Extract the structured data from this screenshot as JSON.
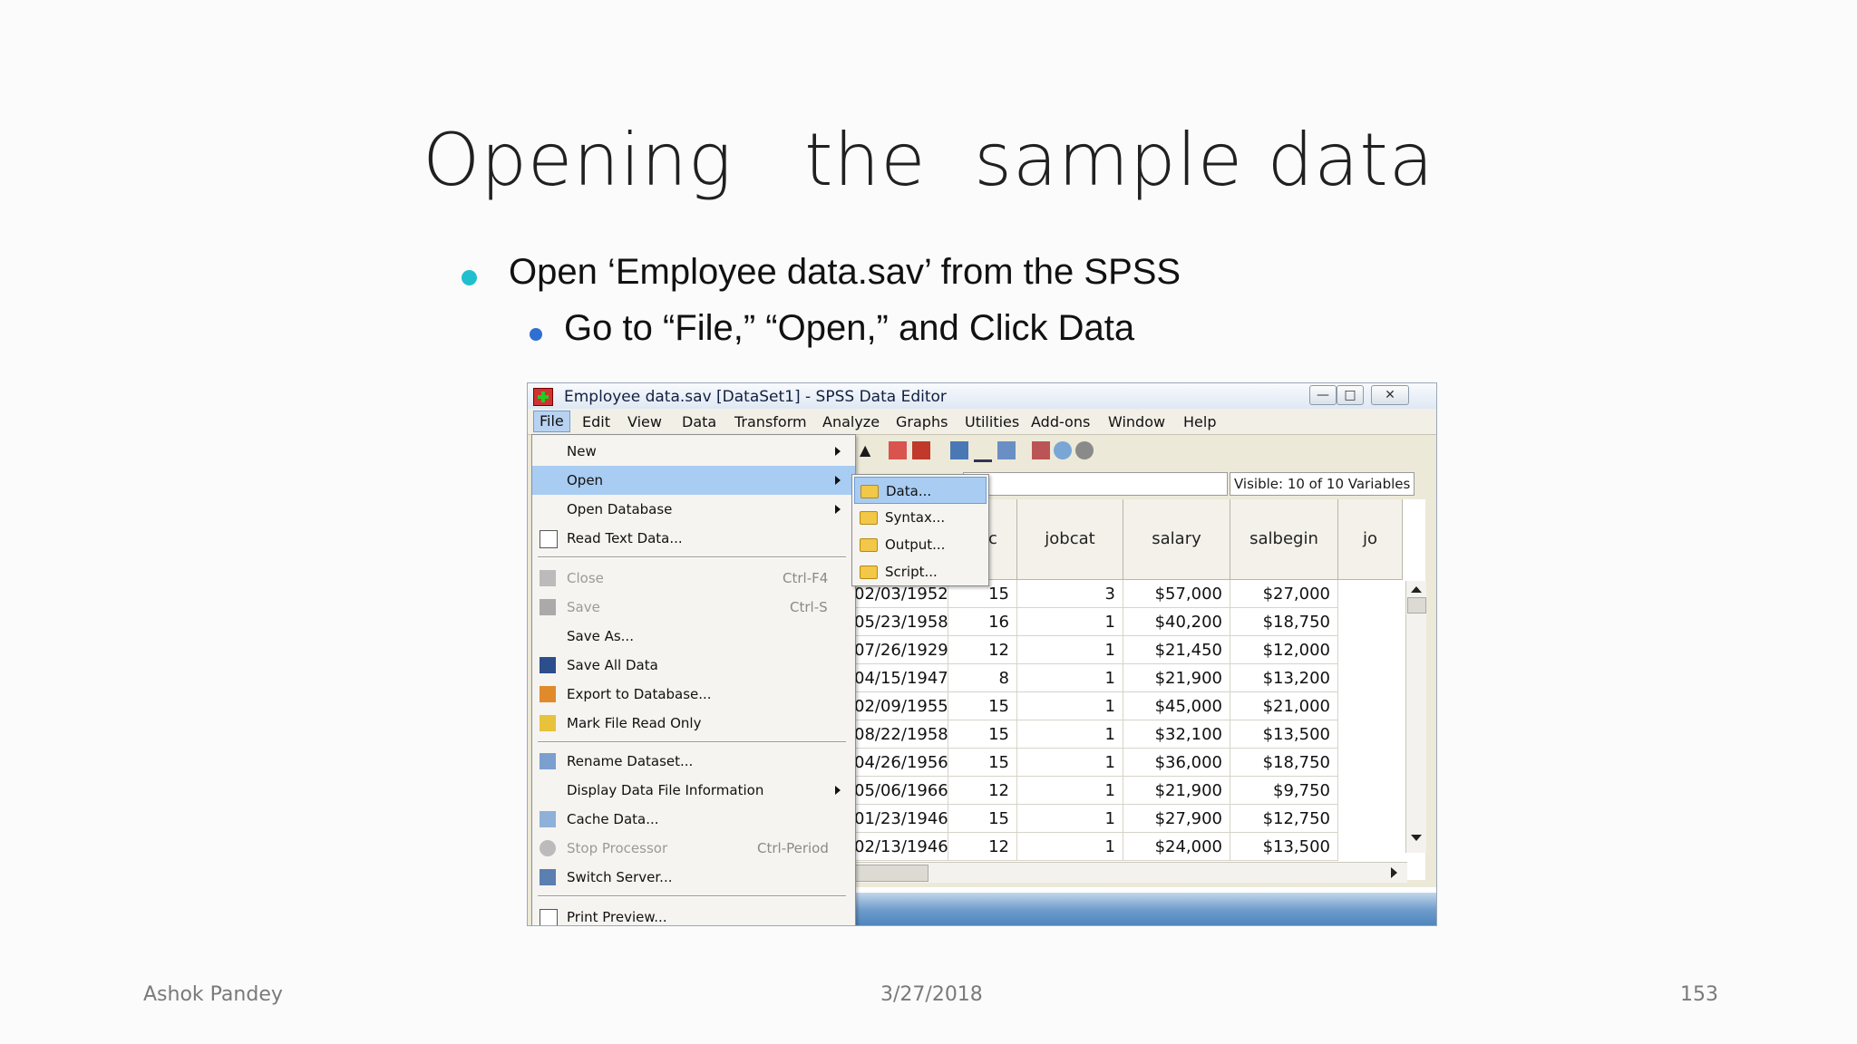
{
  "slide": {
    "title": "Opening   the  sample data",
    "bullet1": "Open ‘Employee data.sav’ from the SPSS",
    "bullet2": "Go to “File,” “Open,” and Click Data",
    "footer_author": "Ashok Pandey",
    "footer_date": "3/27/2018",
    "footer_page": "153"
  },
  "window": {
    "title": "Employee data.sav [DataSet1] - SPSS Data Editor",
    "menu": [
      "File",
      "Edit",
      "View",
      "Data",
      "Transform",
      "Analyze",
      "Graphs",
      "Utilities",
      "Add-ons",
      "Window",
      "Help"
    ],
    "visible_vars": "Visible: 10 of 10 Variables"
  },
  "file_menu": {
    "new": "New",
    "open": "Open",
    "open_database": "Open Database",
    "read_text": "Read Text Data...",
    "close": "Close",
    "close_sc": "Ctrl-F4",
    "save": "Save",
    "save_sc": "Ctrl-S",
    "save_as": "Save As...",
    "save_all": "Save All Data",
    "export_db": "Export to Database...",
    "mark_readonly": "Mark File Read Only",
    "rename": "Rename Dataset...",
    "display_info": "Display Data File Information",
    "cache": "Cache Data...",
    "stop": "Stop Processor",
    "stop_sc": "Ctrl-Period",
    "switch_server": "Switch Server...",
    "print_preview": "Print Preview..."
  },
  "open_submenu": [
    "Data...",
    "Syntax...",
    "Output...",
    "Script..."
  ],
  "grid": {
    "headers": [
      "duc",
      "jobcat",
      "salary",
      "salbegin",
      "jo"
    ],
    "rows": [
      [
        "02/03/1952",
        "15",
        "3",
        "$57,000",
        "$27,000"
      ],
      [
        "05/23/1958",
        "16",
        "1",
        "$40,200",
        "$18,750"
      ],
      [
        "07/26/1929",
        "12",
        "1",
        "$21,450",
        "$12,000"
      ],
      [
        "04/15/1947",
        "8",
        "1",
        "$21,900",
        "$13,200"
      ],
      [
        "02/09/1955",
        "15",
        "1",
        "$45,000",
        "$21,000"
      ],
      [
        "08/22/1958",
        "15",
        "1",
        "$32,100",
        "$13,500"
      ],
      [
        "04/26/1956",
        "15",
        "1",
        "$36,000",
        "$18,750"
      ],
      [
        "05/06/1966",
        "12",
        "1",
        "$21,900",
        "$9,750"
      ],
      [
        "01/23/1946",
        "15",
        "1",
        "$27,900",
        "$12,750"
      ],
      [
        "02/13/1946",
        "12",
        "1",
        "$24,000",
        "$13,500"
      ]
    ]
  },
  "colors": {
    "bullet1": "#1fbfd0",
    "bullet2": "#2f6fd1",
    "highlight": "#a9ccf2"
  }
}
